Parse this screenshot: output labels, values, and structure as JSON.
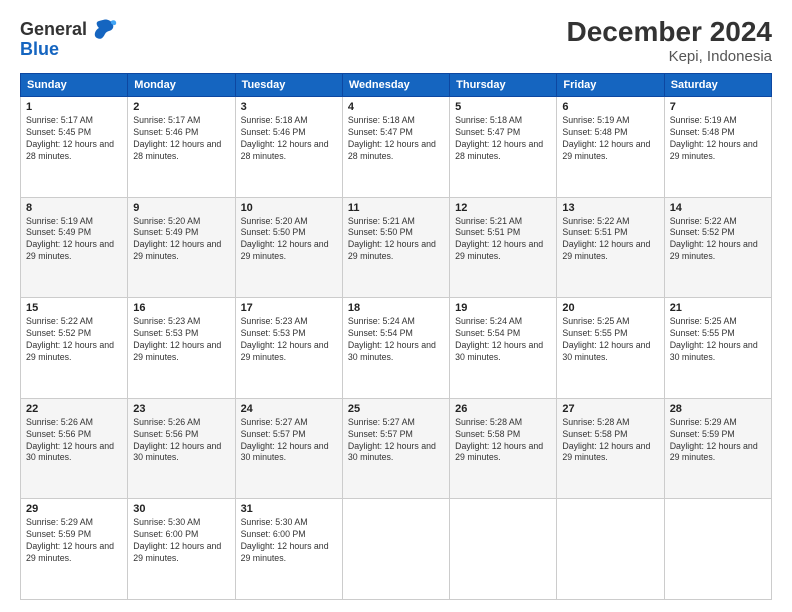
{
  "logo": {
    "general": "General",
    "blue": "Blue"
  },
  "title": "December 2024",
  "subtitle": "Kepi, Indonesia",
  "days_of_week": [
    "Sunday",
    "Monday",
    "Tuesday",
    "Wednesday",
    "Thursday",
    "Friday",
    "Saturday"
  ],
  "weeks": [
    [
      {
        "day": "1",
        "sunrise": "Sunrise: 5:17 AM",
        "sunset": "Sunset: 5:45 PM",
        "daylight": "Daylight: 12 hours and 28 minutes."
      },
      {
        "day": "2",
        "sunrise": "Sunrise: 5:17 AM",
        "sunset": "Sunset: 5:46 PM",
        "daylight": "Daylight: 12 hours and 28 minutes."
      },
      {
        "day": "3",
        "sunrise": "Sunrise: 5:18 AM",
        "sunset": "Sunset: 5:46 PM",
        "daylight": "Daylight: 12 hours and 28 minutes."
      },
      {
        "day": "4",
        "sunrise": "Sunrise: 5:18 AM",
        "sunset": "Sunset: 5:47 PM",
        "daylight": "Daylight: 12 hours and 28 minutes."
      },
      {
        "day": "5",
        "sunrise": "Sunrise: 5:18 AM",
        "sunset": "Sunset: 5:47 PM",
        "daylight": "Daylight: 12 hours and 28 minutes."
      },
      {
        "day": "6",
        "sunrise": "Sunrise: 5:19 AM",
        "sunset": "Sunset: 5:48 PM",
        "daylight": "Daylight: 12 hours and 29 minutes."
      },
      {
        "day": "7",
        "sunrise": "Sunrise: 5:19 AM",
        "sunset": "Sunset: 5:48 PM",
        "daylight": "Daylight: 12 hours and 29 minutes."
      }
    ],
    [
      {
        "day": "8",
        "sunrise": "Sunrise: 5:19 AM",
        "sunset": "Sunset: 5:49 PM",
        "daylight": "Daylight: 12 hours and 29 minutes."
      },
      {
        "day": "9",
        "sunrise": "Sunrise: 5:20 AM",
        "sunset": "Sunset: 5:49 PM",
        "daylight": "Daylight: 12 hours and 29 minutes."
      },
      {
        "day": "10",
        "sunrise": "Sunrise: 5:20 AM",
        "sunset": "Sunset: 5:50 PM",
        "daylight": "Daylight: 12 hours and 29 minutes."
      },
      {
        "day": "11",
        "sunrise": "Sunrise: 5:21 AM",
        "sunset": "Sunset: 5:50 PM",
        "daylight": "Daylight: 12 hours and 29 minutes."
      },
      {
        "day": "12",
        "sunrise": "Sunrise: 5:21 AM",
        "sunset": "Sunset: 5:51 PM",
        "daylight": "Daylight: 12 hours and 29 minutes."
      },
      {
        "day": "13",
        "sunrise": "Sunrise: 5:22 AM",
        "sunset": "Sunset: 5:51 PM",
        "daylight": "Daylight: 12 hours and 29 minutes."
      },
      {
        "day": "14",
        "sunrise": "Sunrise: 5:22 AM",
        "sunset": "Sunset: 5:52 PM",
        "daylight": "Daylight: 12 hours and 29 minutes."
      }
    ],
    [
      {
        "day": "15",
        "sunrise": "Sunrise: 5:22 AM",
        "sunset": "Sunset: 5:52 PM",
        "daylight": "Daylight: 12 hours and 29 minutes."
      },
      {
        "day": "16",
        "sunrise": "Sunrise: 5:23 AM",
        "sunset": "Sunset: 5:53 PM",
        "daylight": "Daylight: 12 hours and 29 minutes."
      },
      {
        "day": "17",
        "sunrise": "Sunrise: 5:23 AM",
        "sunset": "Sunset: 5:53 PM",
        "daylight": "Daylight: 12 hours and 29 minutes."
      },
      {
        "day": "18",
        "sunrise": "Sunrise: 5:24 AM",
        "sunset": "Sunset: 5:54 PM",
        "daylight": "Daylight: 12 hours and 30 minutes."
      },
      {
        "day": "19",
        "sunrise": "Sunrise: 5:24 AM",
        "sunset": "Sunset: 5:54 PM",
        "daylight": "Daylight: 12 hours and 30 minutes."
      },
      {
        "day": "20",
        "sunrise": "Sunrise: 5:25 AM",
        "sunset": "Sunset: 5:55 PM",
        "daylight": "Daylight: 12 hours and 30 minutes."
      },
      {
        "day": "21",
        "sunrise": "Sunrise: 5:25 AM",
        "sunset": "Sunset: 5:55 PM",
        "daylight": "Daylight: 12 hours and 30 minutes."
      }
    ],
    [
      {
        "day": "22",
        "sunrise": "Sunrise: 5:26 AM",
        "sunset": "Sunset: 5:56 PM",
        "daylight": "Daylight: 12 hours and 30 minutes."
      },
      {
        "day": "23",
        "sunrise": "Sunrise: 5:26 AM",
        "sunset": "Sunset: 5:56 PM",
        "daylight": "Daylight: 12 hours and 30 minutes."
      },
      {
        "day": "24",
        "sunrise": "Sunrise: 5:27 AM",
        "sunset": "Sunset: 5:57 PM",
        "daylight": "Daylight: 12 hours and 30 minutes."
      },
      {
        "day": "25",
        "sunrise": "Sunrise: 5:27 AM",
        "sunset": "Sunset: 5:57 PM",
        "daylight": "Daylight: 12 hours and 30 minutes."
      },
      {
        "day": "26",
        "sunrise": "Sunrise: 5:28 AM",
        "sunset": "Sunset: 5:58 PM",
        "daylight": "Daylight: 12 hours and 29 minutes."
      },
      {
        "day": "27",
        "sunrise": "Sunrise: 5:28 AM",
        "sunset": "Sunset: 5:58 PM",
        "daylight": "Daylight: 12 hours and 29 minutes."
      },
      {
        "day": "28",
        "sunrise": "Sunrise: 5:29 AM",
        "sunset": "Sunset: 5:59 PM",
        "daylight": "Daylight: 12 hours and 29 minutes."
      }
    ],
    [
      {
        "day": "29",
        "sunrise": "Sunrise: 5:29 AM",
        "sunset": "Sunset: 5:59 PM",
        "daylight": "Daylight: 12 hours and 29 minutes."
      },
      {
        "day": "30",
        "sunrise": "Sunrise: 5:30 AM",
        "sunset": "Sunset: 6:00 PM",
        "daylight": "Daylight: 12 hours and 29 minutes."
      },
      {
        "day": "31",
        "sunrise": "Sunrise: 5:30 AM",
        "sunset": "Sunset: 6:00 PM",
        "daylight": "Daylight: 12 hours and 29 minutes."
      },
      null,
      null,
      null,
      null
    ]
  ]
}
